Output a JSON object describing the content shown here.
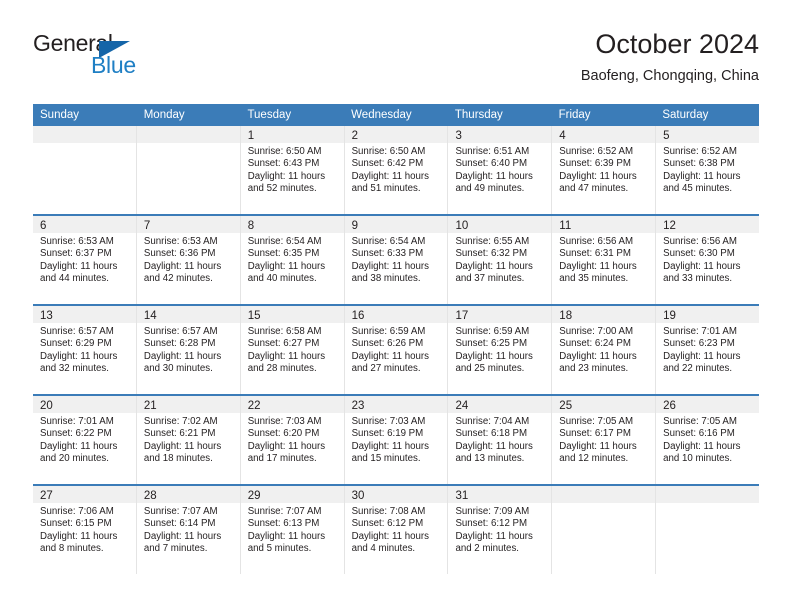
{
  "brand": {
    "name_part1": "General",
    "name_part2": "Blue",
    "color_primary": "#1565a8",
    "color_secondary": "#1f7fc4"
  },
  "header": {
    "title": "October 2024",
    "subtitle": "Baofeng, Chongqing, China"
  },
  "theme": {
    "header_blue": "#3b7cb8",
    "day_band_gray": "#f0f0f0",
    "text": "#231f20"
  },
  "weekdays": [
    "Sunday",
    "Monday",
    "Tuesday",
    "Wednesday",
    "Thursday",
    "Friday",
    "Saturday"
  ],
  "weeks": [
    [
      {
        "day": "",
        "lines": []
      },
      {
        "day": "",
        "lines": []
      },
      {
        "day": "1",
        "lines": [
          "Sunrise: 6:50 AM",
          "Sunset: 6:43 PM",
          "Daylight: 11 hours",
          "and 52 minutes."
        ]
      },
      {
        "day": "2",
        "lines": [
          "Sunrise: 6:50 AM",
          "Sunset: 6:42 PM",
          "Daylight: 11 hours",
          "and 51 minutes."
        ]
      },
      {
        "day": "3",
        "lines": [
          "Sunrise: 6:51 AM",
          "Sunset: 6:40 PM",
          "Daylight: 11 hours",
          "and 49 minutes."
        ]
      },
      {
        "day": "4",
        "lines": [
          "Sunrise: 6:52 AM",
          "Sunset: 6:39 PM",
          "Daylight: 11 hours",
          "and 47 minutes."
        ]
      },
      {
        "day": "5",
        "lines": [
          "Sunrise: 6:52 AM",
          "Sunset: 6:38 PM",
          "Daylight: 11 hours",
          "and 45 minutes."
        ]
      }
    ],
    [
      {
        "day": "6",
        "lines": [
          "Sunrise: 6:53 AM",
          "Sunset: 6:37 PM",
          "Daylight: 11 hours",
          "and 44 minutes."
        ]
      },
      {
        "day": "7",
        "lines": [
          "Sunrise: 6:53 AM",
          "Sunset: 6:36 PM",
          "Daylight: 11 hours",
          "and 42 minutes."
        ]
      },
      {
        "day": "8",
        "lines": [
          "Sunrise: 6:54 AM",
          "Sunset: 6:35 PM",
          "Daylight: 11 hours",
          "and 40 minutes."
        ]
      },
      {
        "day": "9",
        "lines": [
          "Sunrise: 6:54 AM",
          "Sunset: 6:33 PM",
          "Daylight: 11 hours",
          "and 38 minutes."
        ]
      },
      {
        "day": "10",
        "lines": [
          "Sunrise: 6:55 AM",
          "Sunset: 6:32 PM",
          "Daylight: 11 hours",
          "and 37 minutes."
        ]
      },
      {
        "day": "11",
        "lines": [
          "Sunrise: 6:56 AM",
          "Sunset: 6:31 PM",
          "Daylight: 11 hours",
          "and 35 minutes."
        ]
      },
      {
        "day": "12",
        "lines": [
          "Sunrise: 6:56 AM",
          "Sunset: 6:30 PM",
          "Daylight: 11 hours",
          "and 33 minutes."
        ]
      }
    ],
    [
      {
        "day": "13",
        "lines": [
          "Sunrise: 6:57 AM",
          "Sunset: 6:29 PM",
          "Daylight: 11 hours",
          "and 32 minutes."
        ]
      },
      {
        "day": "14",
        "lines": [
          "Sunrise: 6:57 AM",
          "Sunset: 6:28 PM",
          "Daylight: 11 hours",
          "and 30 minutes."
        ]
      },
      {
        "day": "15",
        "lines": [
          "Sunrise: 6:58 AM",
          "Sunset: 6:27 PM",
          "Daylight: 11 hours",
          "and 28 minutes."
        ]
      },
      {
        "day": "16",
        "lines": [
          "Sunrise: 6:59 AM",
          "Sunset: 6:26 PM",
          "Daylight: 11 hours",
          "and 27 minutes."
        ]
      },
      {
        "day": "17",
        "lines": [
          "Sunrise: 6:59 AM",
          "Sunset: 6:25 PM",
          "Daylight: 11 hours",
          "and 25 minutes."
        ]
      },
      {
        "day": "18",
        "lines": [
          "Sunrise: 7:00 AM",
          "Sunset: 6:24 PM",
          "Daylight: 11 hours",
          "and 23 minutes."
        ]
      },
      {
        "day": "19",
        "lines": [
          "Sunrise: 7:01 AM",
          "Sunset: 6:23 PM",
          "Daylight: 11 hours",
          "and 22 minutes."
        ]
      }
    ],
    [
      {
        "day": "20",
        "lines": [
          "Sunrise: 7:01 AM",
          "Sunset: 6:22 PM",
          "Daylight: 11 hours",
          "and 20 minutes."
        ]
      },
      {
        "day": "21",
        "lines": [
          "Sunrise: 7:02 AM",
          "Sunset: 6:21 PM",
          "Daylight: 11 hours",
          "and 18 minutes."
        ]
      },
      {
        "day": "22",
        "lines": [
          "Sunrise: 7:03 AM",
          "Sunset: 6:20 PM",
          "Daylight: 11 hours",
          "and 17 minutes."
        ]
      },
      {
        "day": "23",
        "lines": [
          "Sunrise: 7:03 AM",
          "Sunset: 6:19 PM",
          "Daylight: 11 hours",
          "and 15 minutes."
        ]
      },
      {
        "day": "24",
        "lines": [
          "Sunrise: 7:04 AM",
          "Sunset: 6:18 PM",
          "Daylight: 11 hours",
          "and 13 minutes."
        ]
      },
      {
        "day": "25",
        "lines": [
          "Sunrise: 7:05 AM",
          "Sunset: 6:17 PM",
          "Daylight: 11 hours",
          "and 12 minutes."
        ]
      },
      {
        "day": "26",
        "lines": [
          "Sunrise: 7:05 AM",
          "Sunset: 6:16 PM",
          "Daylight: 11 hours",
          "and 10 minutes."
        ]
      }
    ],
    [
      {
        "day": "27",
        "lines": [
          "Sunrise: 7:06 AM",
          "Sunset: 6:15 PM",
          "Daylight: 11 hours",
          "and 8 minutes."
        ]
      },
      {
        "day": "28",
        "lines": [
          "Sunrise: 7:07 AM",
          "Sunset: 6:14 PM",
          "Daylight: 11 hours",
          "and 7 minutes."
        ]
      },
      {
        "day": "29",
        "lines": [
          "Sunrise: 7:07 AM",
          "Sunset: 6:13 PM",
          "Daylight: 11 hours",
          "and 5 minutes."
        ]
      },
      {
        "day": "30",
        "lines": [
          "Sunrise: 7:08 AM",
          "Sunset: 6:12 PM",
          "Daylight: 11 hours",
          "and 4 minutes."
        ]
      },
      {
        "day": "31",
        "lines": [
          "Sunrise: 7:09 AM",
          "Sunset: 6:12 PM",
          "Daylight: 11 hours",
          "and 2 minutes."
        ]
      },
      {
        "day": "",
        "lines": []
      },
      {
        "day": "",
        "lines": []
      }
    ]
  ]
}
